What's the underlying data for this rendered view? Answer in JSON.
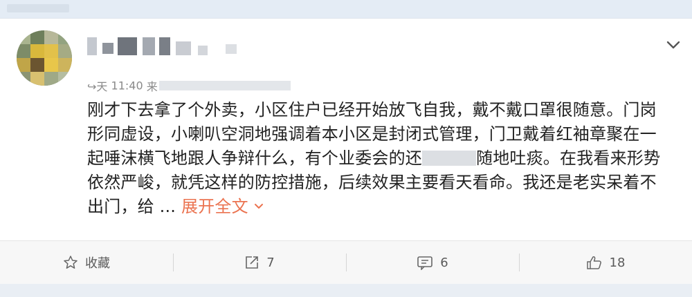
{
  "post": {
    "time_prefix": "↪天",
    "time": "11:40",
    "source_prefix": "来",
    "lines": [
      "刚才下去拿了个外卖，小区住户已经开始放飞自我，戴不戴口罩很随意。门岗",
      "形同虚设，小喇叭空洞地强调着本小区是封闭式管理，门卫戴着红袖章聚在一",
      "起唾沫横飞地跟人争辩什么，有个业委会的还",
      "随地吐痰。在我看来形势",
      "依然严峻，就凭这样的防控措施，后续效果主要看天看命。我还是老实呆着不",
      "出门，给 ..."
    ],
    "expand_label": "展开全文"
  },
  "actions": {
    "favorite_label": "收藏",
    "repost_count": "7",
    "comment_count": "6",
    "like_count": "18"
  },
  "colors": {
    "accent": "#eb7350",
    "background": "#eaf0f7",
    "card": "#ffffff"
  },
  "icons": [
    "chevron-down-icon",
    "star-icon",
    "repost-icon",
    "comment-icon",
    "like-icon"
  ]
}
